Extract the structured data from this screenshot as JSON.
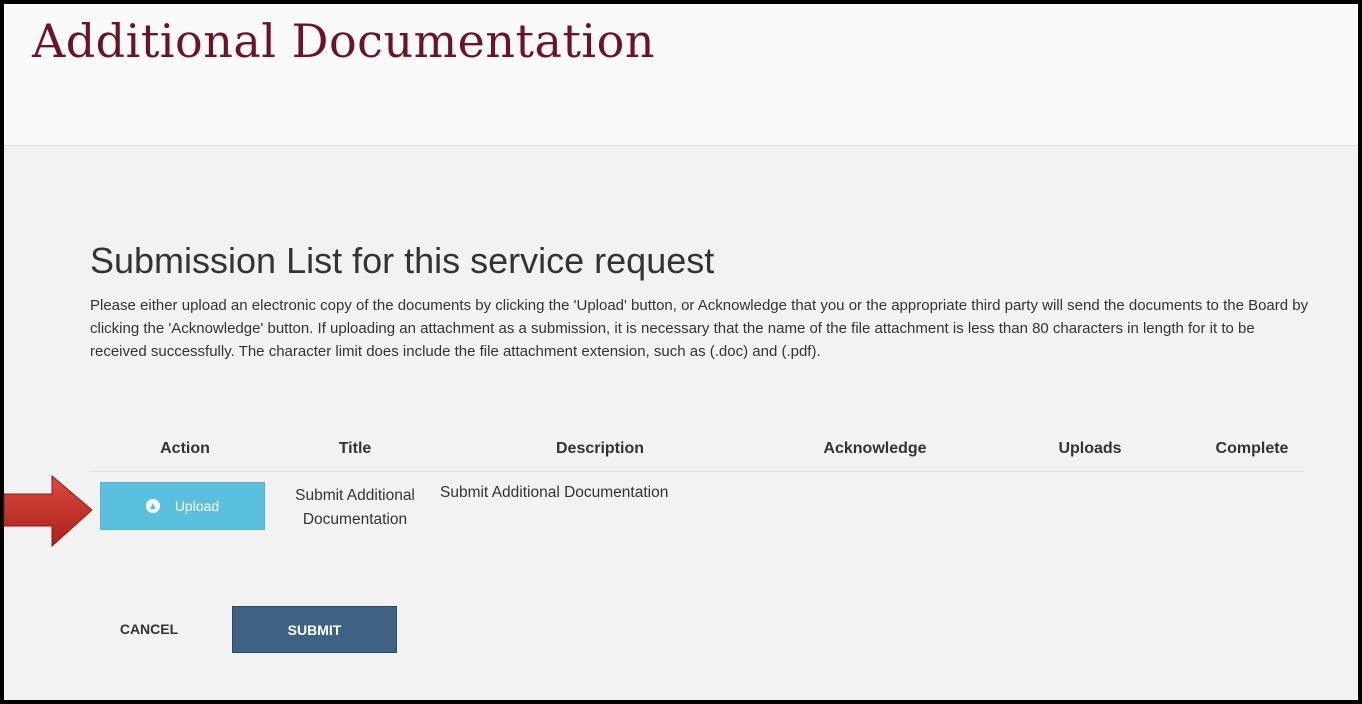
{
  "header": {
    "title": "Additional Documentation"
  },
  "submission": {
    "heading": "Submission List for this service request",
    "instructions": "Please either upload an electronic copy of the documents by clicking the 'Upload' button, or Acknowledge that you or the appropriate third party will send the documents to the Board by clicking the 'Acknowledge' button. If uploading an attachment as a submission, it is necessary that the name of the file attachment is less than 80 characters in length for it to be received successfully. The character limit does include the file attachment extension, such as (.doc) and (.pdf).",
    "columns": [
      "Action",
      "Title",
      "Description",
      "Acknowledge",
      "Uploads",
      "Complete"
    ],
    "rows": [
      {
        "action_label": "Upload",
        "action_icon": "circle-arrow-up-icon",
        "title": "Submit Additional Documentation",
        "description": "Submit Additional Documentation",
        "acknowledge": "",
        "uploads": "",
        "complete": ""
      }
    ]
  },
  "footer": {
    "cancel_label": "CANCEL",
    "submit_label": "SUBMIT"
  },
  "annotation": {
    "icon": "red-arrow-icon",
    "color": "#c0302a"
  },
  "colors": {
    "title": "#6b1426",
    "upload_button": "#5bc0de",
    "submit_button": "#3e6281"
  }
}
